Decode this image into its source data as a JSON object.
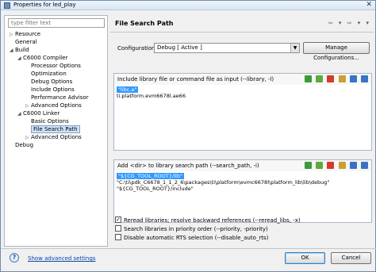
{
  "window": {
    "title": "Properties for led_play",
    "close_glyph": "✕"
  },
  "left_pane": {
    "filter_placeholder": "type filter text",
    "tree": [
      {
        "label": "Resource",
        "depth": 0,
        "arrow": "▷",
        "selected": false
      },
      {
        "label": "General",
        "depth": 0,
        "arrow": "",
        "selected": false
      },
      {
        "label": "Build",
        "depth": 0,
        "arrow": "◢",
        "selected": false
      },
      {
        "label": "C6000 Compiler",
        "depth": 1,
        "arrow": "◢",
        "selected": false
      },
      {
        "label": "Processor Options",
        "depth": 2,
        "arrow": "",
        "selected": false
      },
      {
        "label": "Optimization",
        "depth": 2,
        "arrow": "",
        "selected": false
      },
      {
        "label": "Debug Options",
        "depth": 2,
        "arrow": "",
        "selected": false
      },
      {
        "label": "Include Options",
        "depth": 2,
        "arrow": "",
        "selected": false
      },
      {
        "label": "Performance Advisor",
        "depth": 2,
        "arrow": "",
        "selected": false
      },
      {
        "label": "Advanced Options",
        "depth": 2,
        "arrow": "▷",
        "selected": false
      },
      {
        "label": "C6000 Linker",
        "depth": 1,
        "arrow": "◢",
        "selected": false
      },
      {
        "label": "Basic Options",
        "depth": 2,
        "arrow": "",
        "selected": false
      },
      {
        "label": "File Search Path",
        "depth": 2,
        "arrow": "",
        "selected": true
      },
      {
        "label": "Advanced Options",
        "depth": 2,
        "arrow": "▷",
        "selected": false
      },
      {
        "label": "Debug",
        "depth": 0,
        "arrow": "",
        "selected": false
      }
    ]
  },
  "right_pane": {
    "title": "File Search Path",
    "nav_icons": [
      "back-arrow-icon",
      "back-dropdown-icon",
      "forward-arrow-icon",
      "forward-dropdown-icon",
      "menu-dropdown-icon"
    ],
    "configuration_label": "Configuration:",
    "configuration_value": "Debug  [ Active ]",
    "manage_button": "Manage Configurations...",
    "library_group": {
      "label": "Include library file or command file as input (--library, -l)",
      "items": [
        {
          "text": "\"libc.a\"",
          "selected": true
        },
        {
          "text": "ti.platform.evm6678l.ae66",
          "selected": false
        }
      ]
    },
    "search_group": {
      "label": "Add <dir> to library search path (--search_path, -i)",
      "items": [
        {
          "text": "\"${CG_TOOL_ROOT}/lib\"",
          "selected": true
        },
        {
          "text": "\"C:\\ti\\pdk_C6678_1_1_2_6\\packages\\ti\\platform\\evmc6678l\\platform_lib\\lib\\debug\"",
          "selected": false
        },
        {
          "text": "\"${CG_TOOL_ROOT}/include\"",
          "selected": false
        }
      ]
    },
    "checkboxes": [
      {
        "label": "Reread libraries; resolve backward references (--reread_libs, -x)",
        "checked": true
      },
      {
        "label": "Search libraries in priority order (--priority, -priority)",
        "checked": false
      },
      {
        "label": "Disable automatic RTS selection (--disable_auto_rts)",
        "checked": false
      }
    ]
  },
  "footer": {
    "help_glyph": "?",
    "advanced_link": "Show advanced settings",
    "ok": "OK",
    "cancel": "Cancel"
  }
}
